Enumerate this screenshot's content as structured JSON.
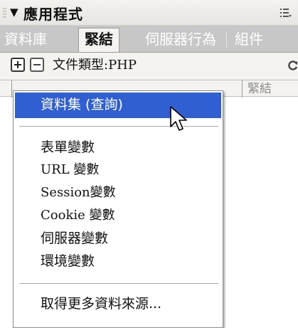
{
  "panel": {
    "title": "應用程式",
    "expander_icon": "triangle-down-icon",
    "options_icon": "panel-options-icon"
  },
  "tabs": [
    {
      "label": "資料庫",
      "active": false
    },
    {
      "label": "緊結",
      "active": true
    },
    {
      "label": "伺服器行為",
      "active": false
    },
    {
      "label": "組件",
      "active": false
    }
  ],
  "toolbar": {
    "add_icon": "plus-icon",
    "remove_icon": "minus-icon",
    "document_type": "文件類型:PHP",
    "refresh_icon": "refresh-icon"
  },
  "columns": {
    "binding_header": "緊結"
  },
  "menu": {
    "items": [
      {
        "label": "資料集 (查詢)",
        "highlighted": true
      },
      {
        "label": "表單變數"
      },
      {
        "label": "URL 變數"
      },
      {
        "label": "Session變數"
      },
      {
        "label": "Cookie 變數"
      },
      {
        "label": "伺服器變數"
      },
      {
        "label": "環境變數"
      },
      {
        "label": "取得更多資料來源..."
      }
    ]
  },
  "colors": {
    "highlight": "#2f5fd1",
    "tab_bar": "#c7c7c7",
    "panel_bg": "#f4f3f0"
  }
}
